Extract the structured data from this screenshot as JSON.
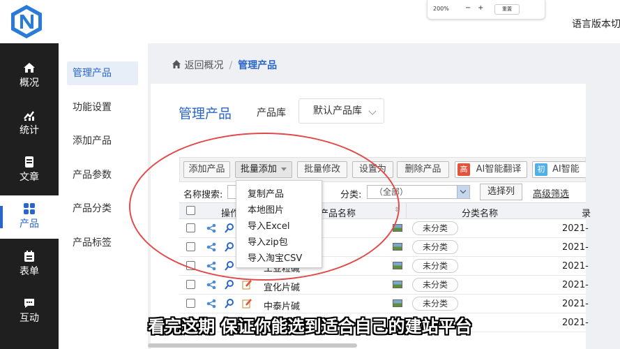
{
  "topbar": {
    "zoom": {
      "value": "200%",
      "minus": "−",
      "plus": "+",
      "reset": "重置"
    },
    "language_switch": "语言版本切换"
  },
  "leftnav": {
    "items": [
      {
        "label": "概况",
        "icon": "home-icon"
      },
      {
        "label": "统计",
        "icon": "chart-icon"
      },
      {
        "label": "文章",
        "icon": "document-icon"
      },
      {
        "label": "产品",
        "icon": "grid-icon"
      },
      {
        "label": "表单",
        "icon": "calendar-form-icon"
      },
      {
        "label": "互动",
        "icon": "chat-icon"
      }
    ],
    "active": "产品"
  },
  "subnav": {
    "items": [
      "管理产品",
      "功能设置",
      "添加产品",
      "产品参数",
      "产品分类",
      "产品标签"
    ],
    "active": "管理产品"
  },
  "breadcrumb": {
    "back": "返回概况",
    "separator": "/",
    "current": "管理产品"
  },
  "panel": {
    "title": "管理产品",
    "library_label": "产品库",
    "library_value": "默认产品库"
  },
  "toolbar": {
    "add": "添加产品",
    "batch_add": "批量添加",
    "batch_edit": "批量修改",
    "set_as": "设置为",
    "delete": "删除产品",
    "ai_translate_badge": "高",
    "ai_translate": "AI智能翻译",
    "ai_second_badge": "初",
    "ai_second": "AI智能",
    "ai_translate_color": "#e2533c",
    "ai_second_color": "#4fb0e8"
  },
  "filters": {
    "name_label": "名称搜索:",
    "category_label": "分类:",
    "category_value": "（全部）",
    "select_columns": "选择列",
    "advanced": "高级筛选"
  },
  "table": {
    "headers": {
      "ops": "操作",
      "name": "产品名称",
      "category": "分类名称",
      "date": "录"
    },
    "rows": [
      {
        "name": "",
        "category": "未分类",
        "date": "2021-"
      },
      {
        "name": "",
        "category": "未分类",
        "date": "2021-"
      },
      {
        "name": "工业粒碱",
        "category": "未分类",
        "date": "2021-"
      },
      {
        "name": "宜化片碱",
        "category": "未分类",
        "date": "2021-"
      },
      {
        "name": "中泰片碱",
        "category": "未分类",
        "date": "2021-"
      },
      {
        "name": "",
        "category": "",
        "date": "2021-"
      }
    ]
  },
  "dropdown": {
    "items": [
      "复制产品",
      "本地图片",
      "导入Excel",
      "导入zip包",
      "导入淘宝CSV"
    ]
  },
  "subtitle": "看完这期  保证你能选到适合自己的建站平台",
  "colors": {
    "accent": "#2a66c9",
    "nav_bg": "#1f1f1f",
    "highlight_circle": "#e24a4a"
  }
}
